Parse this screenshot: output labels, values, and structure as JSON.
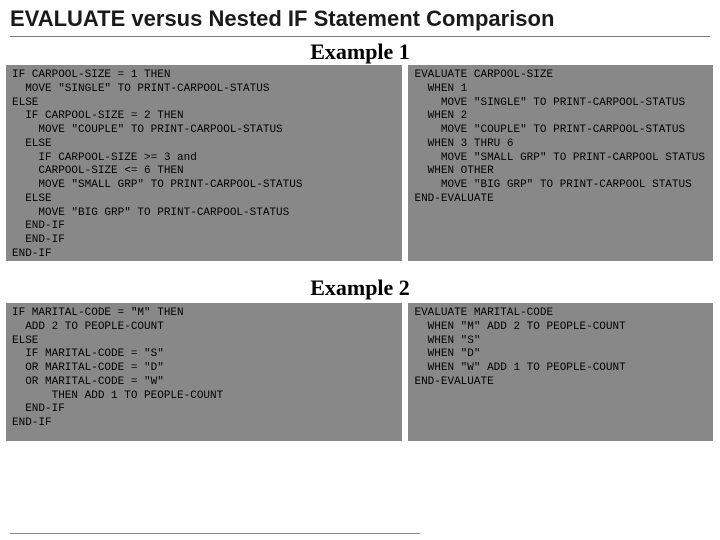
{
  "title": "EVALUATE versus Nested IF Statement Comparison",
  "example1": {
    "label": "Example 1",
    "left": "IF CARPOOL-SIZE = 1 THEN\n  MOVE \"SINGLE\" TO PRINT-CARPOOL-STATUS\nELSE\n  IF CARPOOL-SIZE = 2 THEN\n    MOVE \"COUPLE\" TO PRINT-CARPOOL-STATUS\n  ELSE\n    IF CARPOOL-SIZE >= 3 and\n    CARPOOL-SIZE <= 6 THEN\n    MOVE \"SMALL GRP\" TO PRINT-CARPOOL-STATUS\n  ELSE\n    MOVE \"BIG GRP\" TO PRINT-CARPOOL-STATUS\n  END-IF\n  END-IF\nEND-IF",
    "right": "EVALUATE CARPOOL-SIZE\n  WHEN 1\n    MOVE \"SINGLE\" TO PRINT-CARPOOL-STATUS\n  WHEN 2\n    MOVE \"COUPLE\" TO PRINT-CARPOOL-STATUS\n  WHEN 3 THRU 6\n    MOVE \"SMALL GRP\" TO PRINT-CARPOOL STATUS\n  WHEN OTHER\n    MOVE \"BIG GRP\" TO PRINT-CARPOOL STATUS\nEND-EVALUATE"
  },
  "example2": {
    "label": "Example 2",
    "left": "IF MARITAL-CODE = \"M\" THEN\n  ADD 2 TO PEOPLE-COUNT\nELSE\n  IF MARITAL-CODE = \"S\"\n  OR MARITAL-CODE = \"D\"\n  OR MARITAL-CODE = \"W\"\n      THEN ADD 1 TO PEOPLE-COUNT\n  END-IF\nEND-IF",
    "right": "EVALUATE MARITAL-CODE\n  WHEN \"M\" ADD 2 TO PEOPLE-COUNT\n  WHEN \"S\"\n  WHEN \"D\"\n  WHEN \"W\" ADD 1 TO PEOPLE-COUNT\nEND-EVALUATE"
  }
}
